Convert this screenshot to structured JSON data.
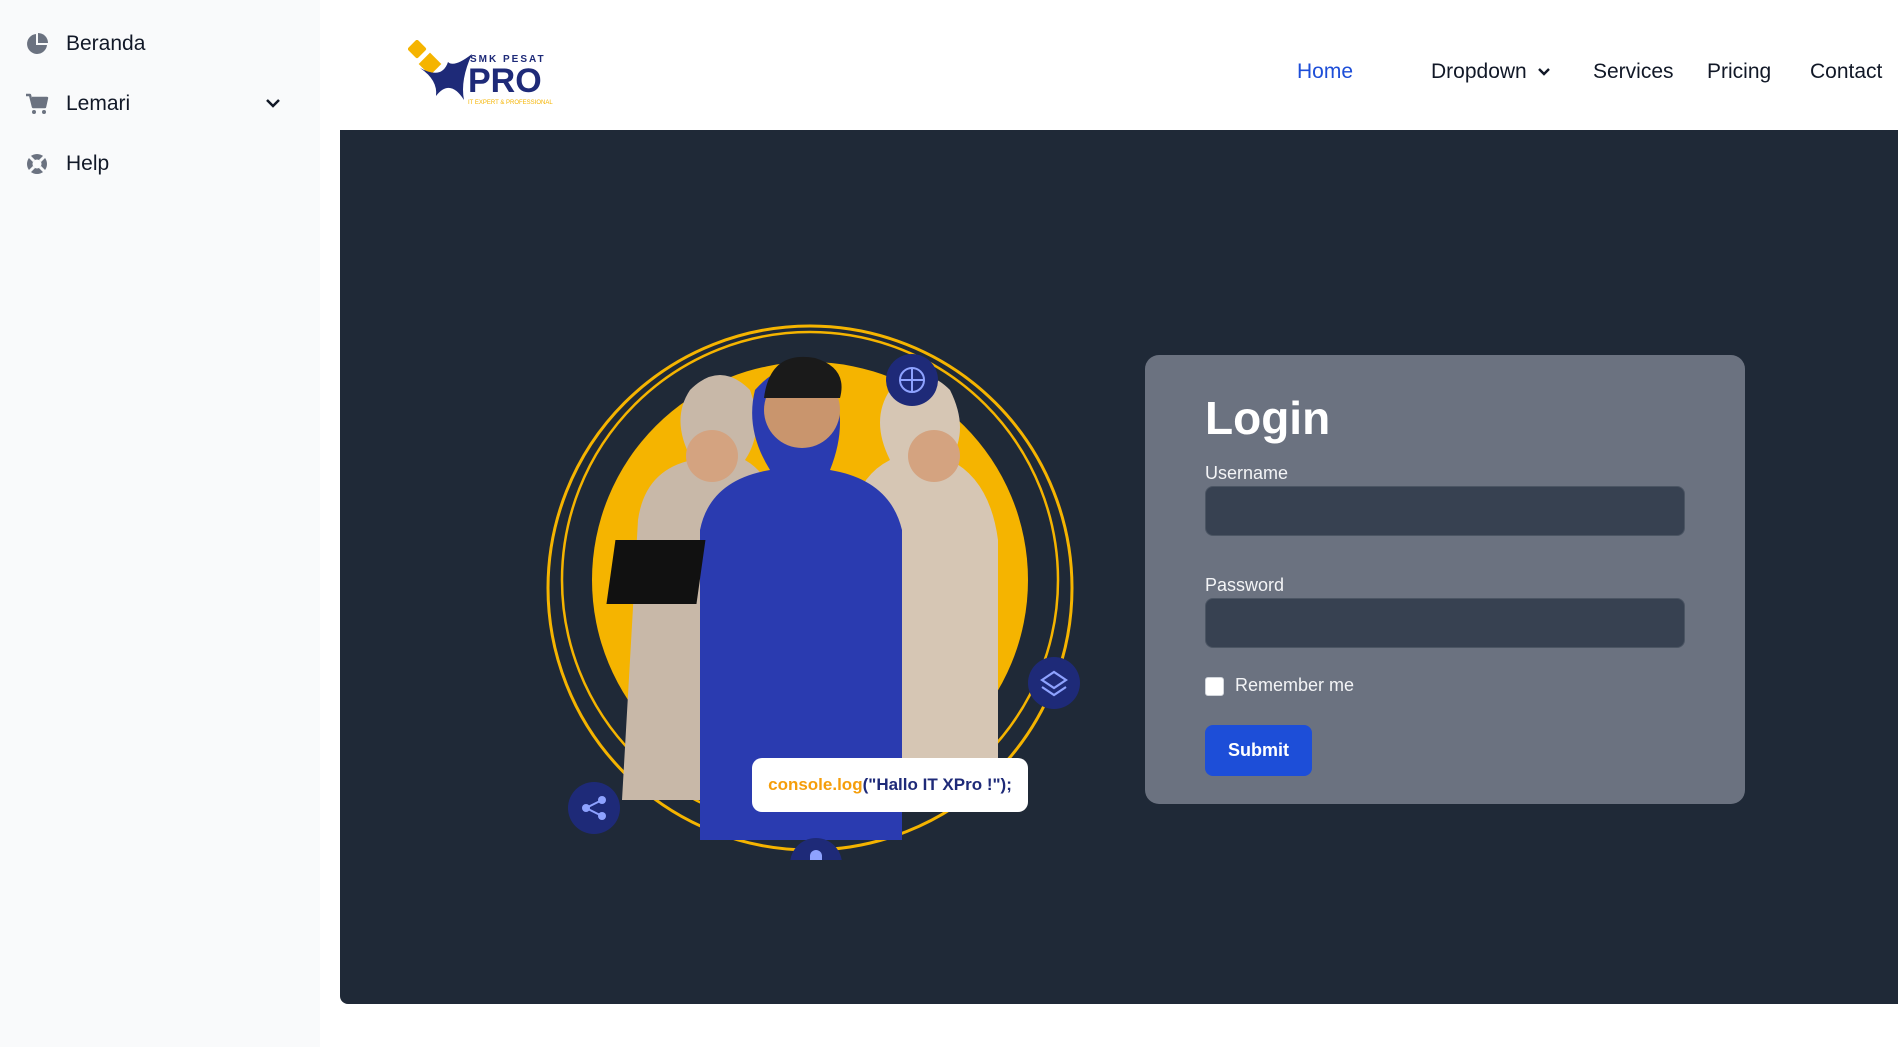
{
  "sidebar": {
    "items": [
      {
        "label": "Beranda",
        "icon": "pie-chart-icon"
      },
      {
        "label": "Lemari",
        "icon": "cart-icon",
        "expandable": true
      },
      {
        "label": "Help",
        "icon": "lifebuoy-icon"
      }
    ]
  },
  "logo": {
    "top": "SMK PESAT",
    "main": "PRO",
    "tagline": "IT EXPERT & PROFESSIONAL"
  },
  "nav": {
    "items": [
      {
        "label": "Home",
        "active": true
      },
      {
        "label": "Dropdown",
        "has_caret": true
      },
      {
        "label": "Services"
      },
      {
        "label": "Pricing"
      },
      {
        "label": "Contact"
      }
    ]
  },
  "hero": {
    "code_bubble": {
      "fn": "console.log",
      "arg": "(\"Hallo IT XPro !\");"
    }
  },
  "login": {
    "title": "Login",
    "username_label": "Username",
    "username_value": "",
    "password_label": "Password",
    "password_value": "",
    "remember_label": "Remember me",
    "submit_label": "Submit"
  },
  "colors": {
    "accent": "#1d4ed8",
    "hero_bg": "#1f2937",
    "card_bg": "#6b7280",
    "brand_yellow": "#f5b400",
    "brand_navy": "#1e2a78"
  }
}
